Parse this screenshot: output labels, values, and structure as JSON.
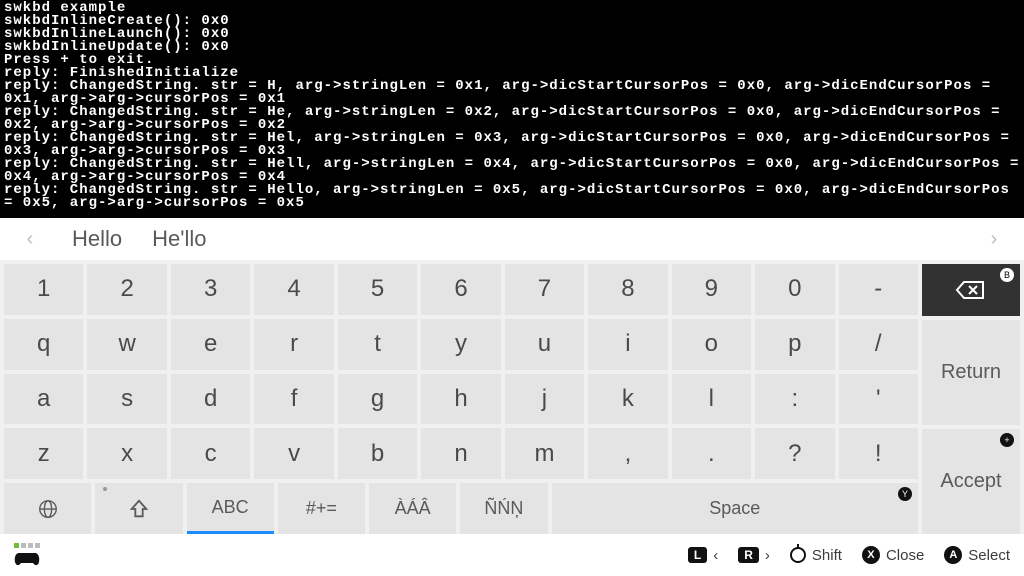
{
  "terminal": {
    "lines": [
      "swkbd example",
      "swkbdInlineCreate(): 0x0",
      "swkbdInlineLaunch(): 0x0",
      "swkbdInlineUpdate(): 0x0",
      "Press + to exit.",
      "reply: FinishedInitialize",
      "reply: ChangedString. str = H, arg->stringLen = 0x1, arg->dicStartCursorPos = 0x0, arg->dicEndCursorPos = 0x1, arg->arg->cursorPos = 0x1",
      "reply: ChangedString. str = He, arg->stringLen = 0x2, arg->dicStartCursorPos = 0x0, arg->dicEndCursorPos = 0x2, arg->arg->cursorPos = 0x2",
      "reply: ChangedString. str = Hel, arg->stringLen = 0x3, arg->dicStartCursorPos = 0x0, arg->dicEndCursorPos = 0x3, arg->arg->cursorPos = 0x3",
      "reply: ChangedString. str = Hell, arg->stringLen = 0x4, arg->dicStartCursorPos = 0x0, arg->dicEndCursorPos = 0x4, arg->arg->cursorPos = 0x4",
      "reply: ChangedString. str = Hello, arg->stringLen = 0x5, arg->dicStartCursorPos = 0x0, arg->dicEndCursorPos = 0x5, arg->arg->cursorPos = 0x5"
    ]
  },
  "suggestions": {
    "w1": "Hello",
    "w2": "He'llo"
  },
  "keys": {
    "r1": [
      "1",
      "2",
      "3",
      "4",
      "5",
      "6",
      "7",
      "8",
      "9",
      "0",
      "-"
    ],
    "r2": [
      "q",
      "w",
      "e",
      "r",
      "t",
      "y",
      "u",
      "i",
      "o",
      "p",
      "/"
    ],
    "r3": [
      "a",
      "s",
      "d",
      "f",
      "g",
      "h",
      "j",
      "k",
      "l",
      ":",
      "'"
    ],
    "r4": [
      "z",
      "x",
      "c",
      "v",
      "b",
      "n",
      "m",
      ",",
      ".",
      "?",
      "!"
    ]
  },
  "side": {
    "return": "Return",
    "accept": "Accept"
  },
  "mode": {
    "abc": "ABC",
    "sym": "#+=",
    "acc1": "ÀÁÂ",
    "acc2": "ÑŃŅ",
    "space": "Space"
  },
  "badges": {
    "b": "B",
    "y": "Y",
    "plus": "+"
  },
  "hints": {
    "shift": "Shift",
    "close": "Close",
    "select": "Select",
    "L": "L",
    "R": "R",
    "X": "X",
    "A": "A"
  }
}
